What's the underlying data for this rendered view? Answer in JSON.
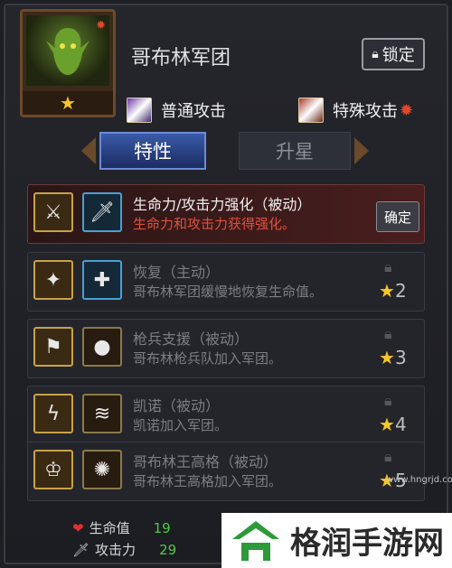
{
  "unit": {
    "name": "哥布林军团",
    "lock_label": "锁定",
    "stars": "★"
  },
  "attacks": {
    "normal": "普通攻击",
    "special": "特殊攻击"
  },
  "tabs": {
    "traits": "特性",
    "upgrade": "升星"
  },
  "skills": [
    {
      "name": "生命力/攻击力强化（被动）",
      "desc": "生命力和攻击力获得强化。",
      "action": "确定",
      "state": "active"
    },
    {
      "name": "恢复（主动）",
      "desc": "哥布林军团缓慢地恢复生命值。",
      "req": "2",
      "state": "locked"
    },
    {
      "name": "枪兵支援（被动）",
      "desc": "哥布林枪兵队加入军团。",
      "req": "3",
      "state": "locked"
    },
    {
      "name": "凯诺（被动）",
      "desc": "凯诺加入军团。",
      "req": "4",
      "state": "locked"
    },
    {
      "name": "哥布林王高格（被动）",
      "desc": "哥布林王高格加入军团。",
      "req": "5",
      "state": "locked"
    }
  ],
  "stats": {
    "hp_label": "生命值",
    "hp_value": "19",
    "atk_label": "攻击力",
    "atk_value": "29"
  },
  "watermark": {
    "text": "格润手游网",
    "url": "www.hngrjd.com"
  }
}
